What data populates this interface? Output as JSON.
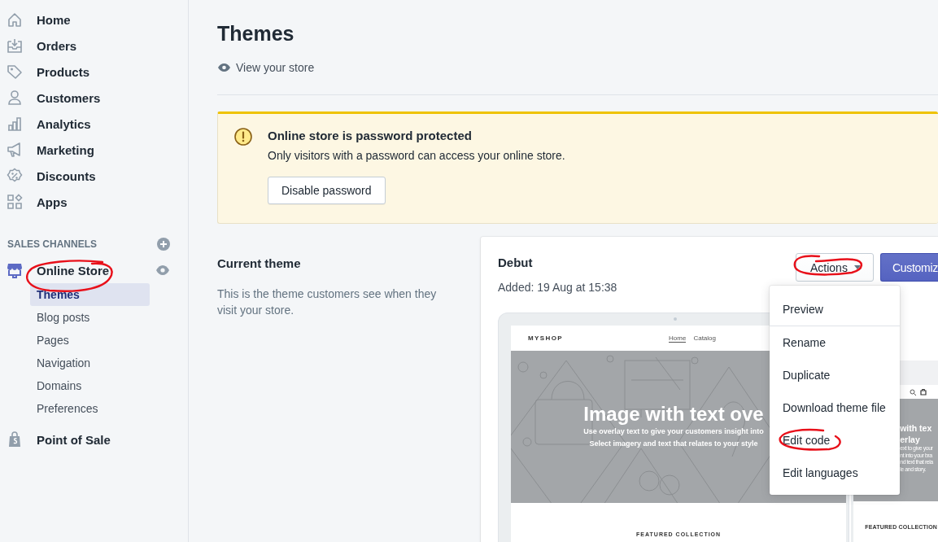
{
  "sidebar": {
    "items": [
      {
        "label": "Home"
      },
      {
        "label": "Orders"
      },
      {
        "label": "Products"
      },
      {
        "label": "Customers"
      },
      {
        "label": "Analytics"
      },
      {
        "label": "Marketing"
      },
      {
        "label": "Discounts"
      },
      {
        "label": "Apps"
      }
    ],
    "section_title": "SALES CHANNELS",
    "channels": [
      {
        "label": "Online Store",
        "marked": true,
        "children": [
          {
            "label": "Themes",
            "selected": true
          },
          {
            "label": "Blog posts",
            "selected": false
          },
          {
            "label": "Pages",
            "selected": false
          },
          {
            "label": "Navigation",
            "selected": false
          },
          {
            "label": "Domains",
            "selected": false
          },
          {
            "label": "Preferences",
            "selected": false
          }
        ]
      },
      {
        "label": "Point of Sale",
        "marked": false
      }
    ]
  },
  "page": {
    "title": "Themes",
    "view_link": "View your store"
  },
  "banner": {
    "title": "Online store is password protected",
    "text": "Only visitors with a password can access your online store.",
    "button": "Disable password"
  },
  "current_theme": {
    "heading": "Current theme",
    "description": "This is the theme customers see when they visit your store.",
    "theme_name": "Debut",
    "added": "Added: 19 Aug at 15:38",
    "actions_button": {
      "label": "Actions",
      "marked": true
    },
    "primary_button": "Customiz",
    "menu": {
      "sections": [
        [
          {
            "label": "Preview",
            "marked": false
          }
        ],
        [
          {
            "label": "Rename",
            "marked": false
          },
          {
            "label": "Duplicate",
            "marked": false
          },
          {
            "label": "Download theme file",
            "marked": false
          },
          {
            "label": "Edit code",
            "marked": true
          },
          {
            "label": "Edit languages",
            "marked": false
          }
        ]
      ]
    },
    "desktop_preview": {
      "brand": "MYSHOP",
      "nav": [
        {
          "label": "Home",
          "selected": true
        },
        {
          "label": "Catalog",
          "selected": false
        }
      ],
      "hero_title": "Image with text ove",
      "hero_lines": [
        "Use overlay text to give your customers insight into",
        "Select imagery and text that relates to your style"
      ],
      "section_title": "FEATURED COLLECTION"
    },
    "mobile_preview": {
      "hero_title_lines": [
        "with tex",
        "erlay"
      ],
      "hero_lines": [
        "ext to give your",
        "nt into your bra",
        "nd text that rela",
        "le and story."
      ],
      "section_title": "FEATURED COLLECTION"
    }
  }
}
